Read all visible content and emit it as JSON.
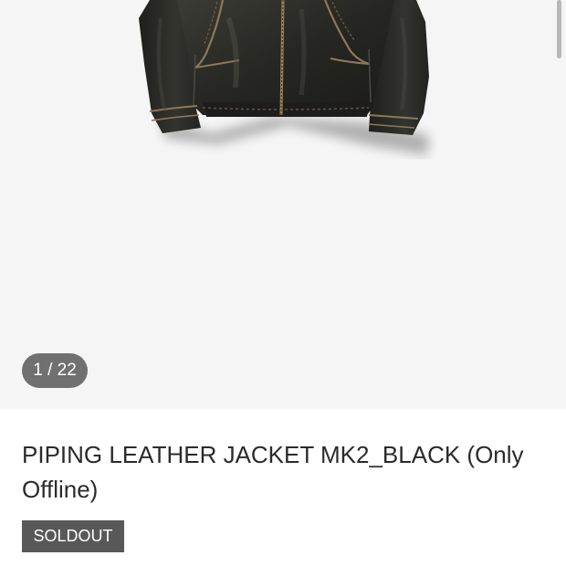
{
  "gallery": {
    "current_image": 1,
    "total_images": 22,
    "counter_text": "1 / 22"
  },
  "product": {
    "title": "PIPING LEATHER JACKET MK2_BLACK (Only Offline)",
    "status_badge": "SOLDOUT"
  },
  "colors": {
    "gallery_bg": "#f5f5f5",
    "counter_bg": "#707070",
    "badge_bg": "#585858",
    "title_text": "#2b2b2b"
  },
  "icons": {
    "product_photo": "leather-jacket-photo"
  }
}
